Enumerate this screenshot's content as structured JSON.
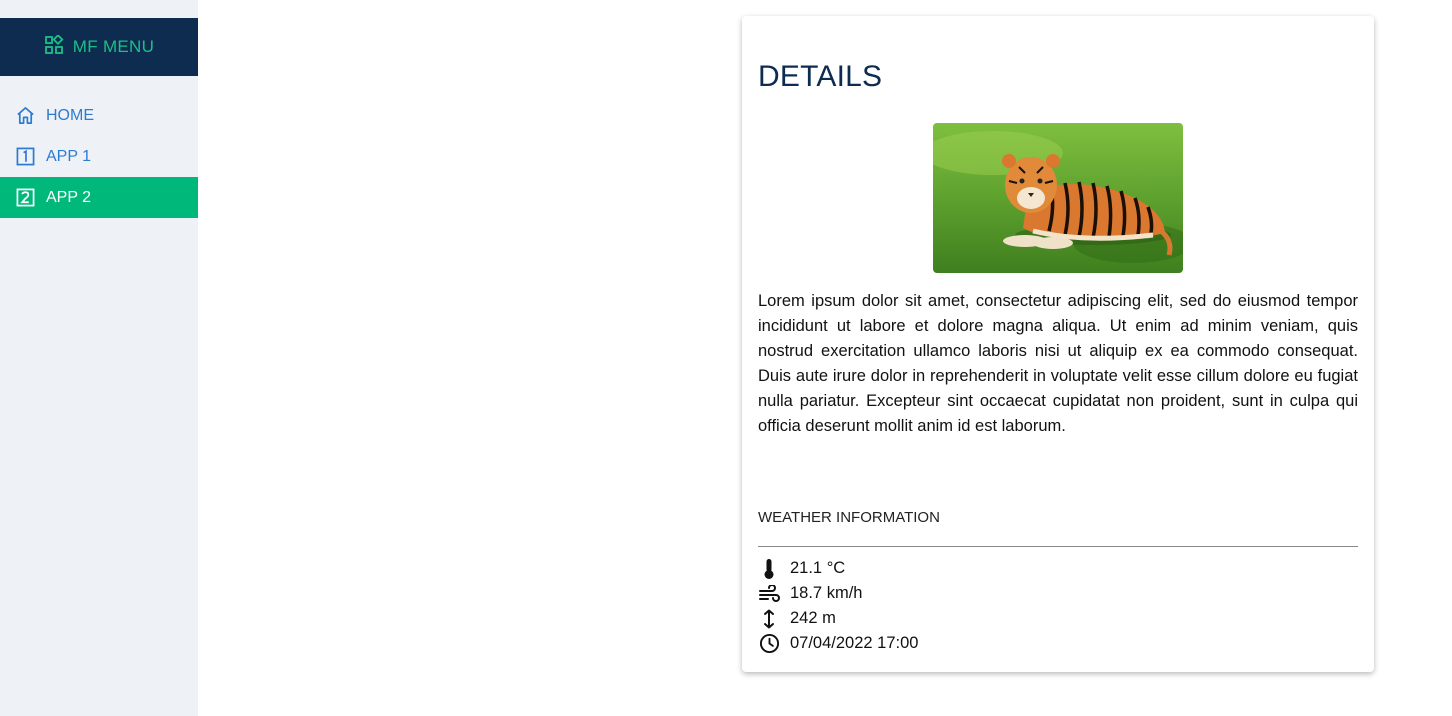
{
  "sidebar": {
    "title": "MF MENU",
    "title_icon": "apps-grid-icon",
    "items": [
      {
        "label": "HOME",
        "icon": "home-icon",
        "active": false
      },
      {
        "label": "APP 1",
        "icon": "number-1-box-icon",
        "active": false
      },
      {
        "label": "APP 2",
        "icon": "number-2-box-icon",
        "active": true
      }
    ]
  },
  "details": {
    "title": "DETAILS",
    "image": "tiger lying on grass",
    "description": "Lorem ipsum dolor sit amet, consectetur adipiscing elit, sed do eiusmod tempor incididunt ut labore et dolore magna aliqua. Ut enim ad minim veniam, quis nostrud exercitation ullamco laboris nisi ut aliquip ex ea commodo consequat. Duis aute irure dolor in reprehenderit in voluptate velit esse cillum dolore eu fugiat nulla pariatur. Excepteur sint occaecat cupidatat non proident, sunt in culpa qui officia deserunt mollit anim id est laborum."
  },
  "weather": {
    "title": "WEATHER INFORMATION",
    "temperature": "21.1 °C",
    "wind": "18.7 km/h",
    "altitude": "242 m",
    "datetime": "07/04/2022 17:00"
  },
  "colors": {
    "sidebar_bg": "#eef2f7",
    "header_bg": "#0d2c4f",
    "accent": "#00b87a",
    "link": "#2c7bd1",
    "title": "#0d2c4f"
  }
}
